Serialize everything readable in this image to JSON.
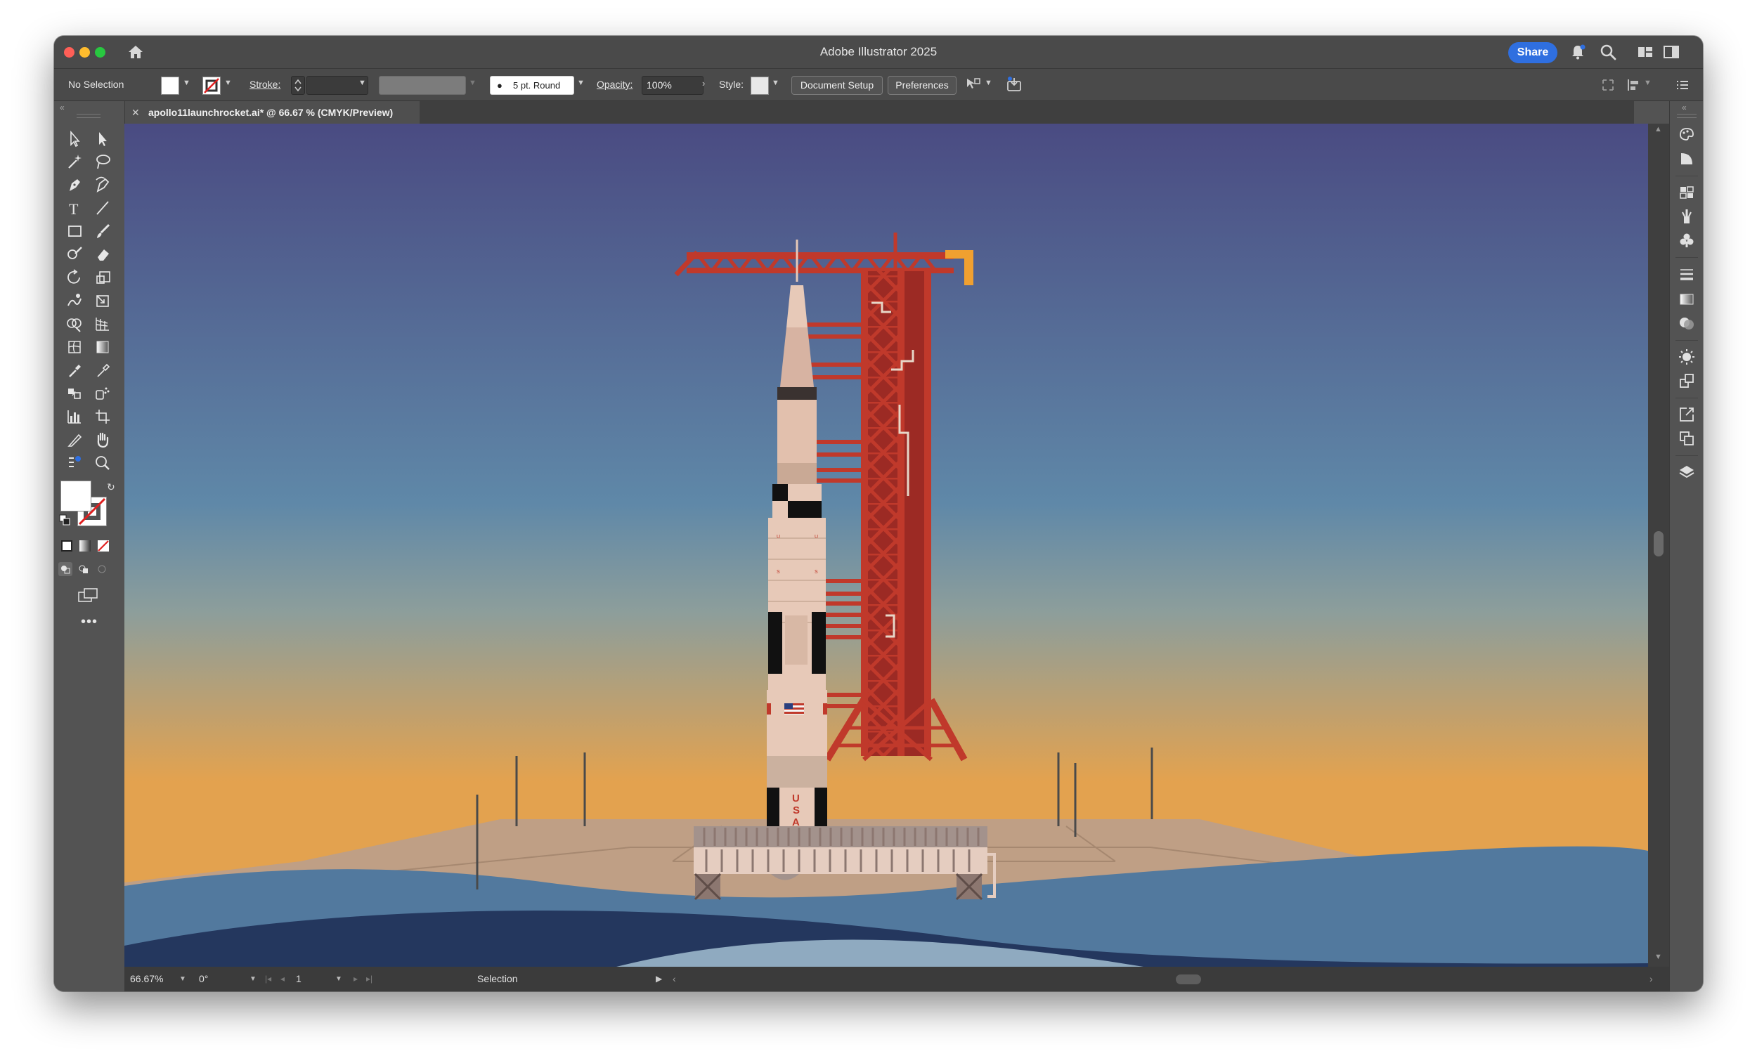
{
  "window": {
    "title": "Adobe Illustrator 2025",
    "share_label": "Share"
  },
  "control_bar": {
    "selection_label": "No Selection",
    "stroke_label": "Stroke:",
    "brush_label": "5 pt. Round",
    "opacity_label": "Opacity:",
    "opacity_value": "100%",
    "style_label": "Style:",
    "document_setup_label": "Document Setup",
    "preferences_label": "Preferences"
  },
  "document_tab": {
    "title": "apollo11launchrocket.ai* @ 66.67 % (CMYK/Preview)"
  },
  "status_bar": {
    "zoom_value": "66.67%",
    "rotation_value": "0°",
    "artboard_value": "1",
    "tool_label": "Selection"
  },
  "artwork": {
    "rocket_letters": [
      "U",
      "S",
      "A"
    ],
    "colors": {
      "sky_top": "#4a4b82",
      "sky_mid": "#5f88a8",
      "sky_bottom": "#e3a24f",
      "tower": "#c0392b",
      "tower_dark": "#9c2a24",
      "rocket_body": "#e7c9b8",
      "ground": "#bf9f85",
      "water_light": "#52799e",
      "water_dark": "#24375e",
      "accent_blue": "#2f6fe0"
    }
  },
  "icons": {
    "home": "home-icon",
    "notifications": "bell-icon",
    "search": "search-icon",
    "workspace": "workspace-icon",
    "panels": "panels-icon"
  }
}
